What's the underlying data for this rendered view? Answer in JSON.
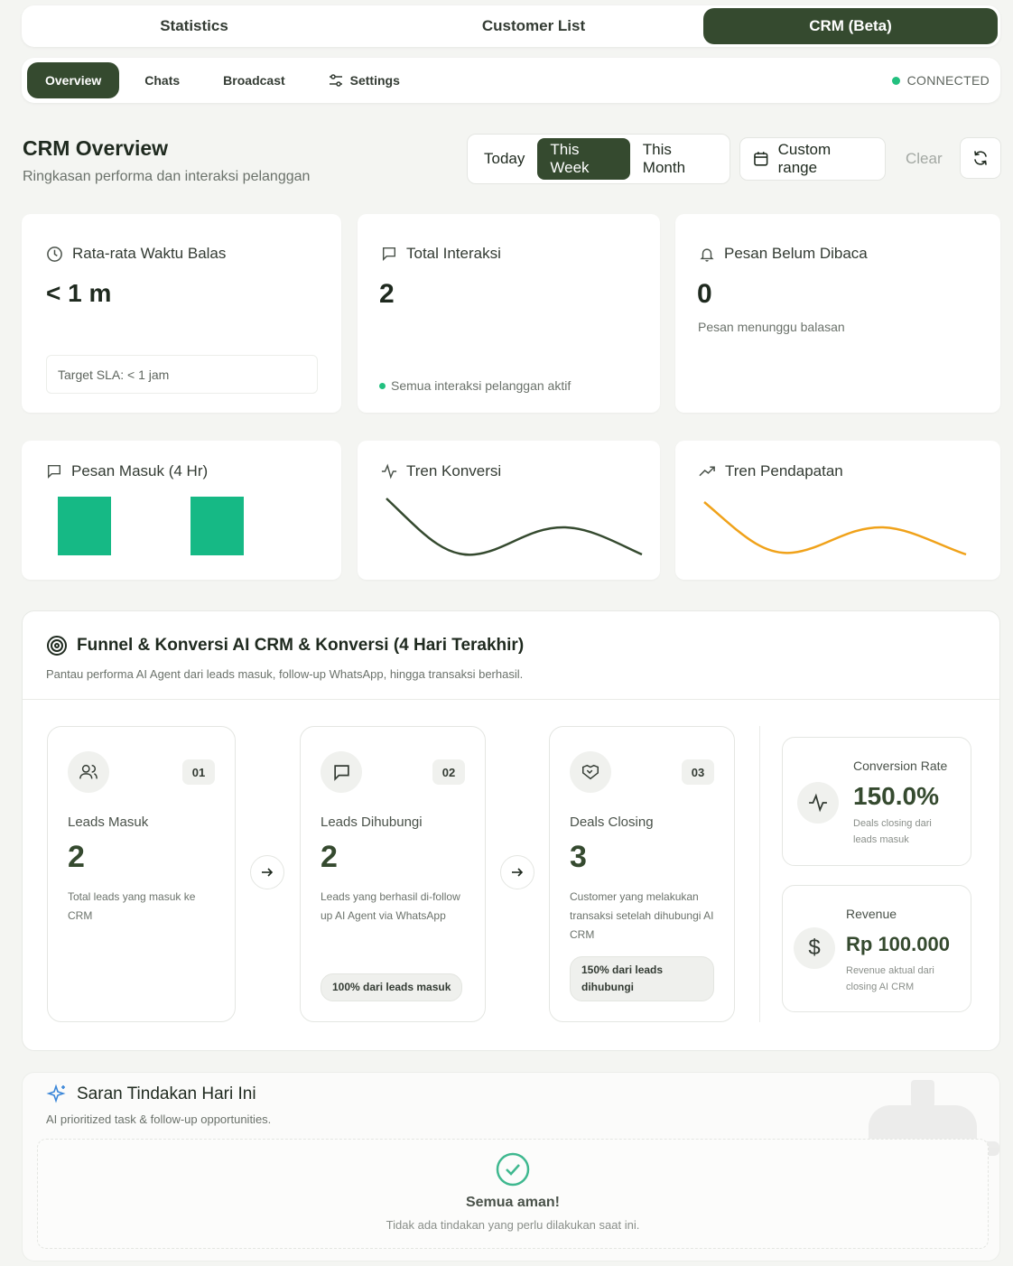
{
  "top_tabs": [
    {
      "label": "Statistics"
    },
    {
      "label": "Customer List"
    },
    {
      "label": "CRM (Beta)"
    }
  ],
  "subnav": {
    "items": [
      {
        "label": "Overview"
      },
      {
        "label": "Chats"
      },
      {
        "label": "Broadcast"
      },
      {
        "label": "Settings",
        "icon": "sliders-icon"
      }
    ],
    "status": "CONNECTED",
    "status_color": "#22c07f"
  },
  "header": {
    "title": "CRM Overview",
    "subtitle": "Ringkasan performa dan interaksi pelanggan",
    "ranges": [
      "Today",
      "This Week",
      "This Month"
    ],
    "active_range": "This Week",
    "custom_range": "Custom range",
    "clear": "Clear"
  },
  "stats": {
    "reply_time": {
      "title": "Rata-rata Waktu Balas",
      "value": "< 1 m",
      "sla": "Target SLA: < 1 jam",
      "icon": "clock-icon"
    },
    "interactions": {
      "title": "Total Interaksi",
      "value": "2",
      "note": "Semua interaksi pelanggan aktif",
      "icon": "message-icon"
    },
    "unread": {
      "title": "Pesan Belum Dibaca",
      "value": "0",
      "note": "Pesan menunggu balasan",
      "icon": "bell-icon"
    }
  },
  "mini_charts": {
    "incoming": {
      "title": "Pesan Masuk (4 Hr)",
      "icon": "message-icon",
      "bar_color": "#16b985"
    },
    "conversion": {
      "title": "Tren Konversi",
      "icon": "activity-icon",
      "line_color": "#354a2f"
    },
    "revenue": {
      "title": "Tren Pendapatan",
      "icon": "trending-up-icon",
      "line_color": "#f0a21a"
    }
  },
  "funnel": {
    "title": "Funnel & Konversi AI CRM & Konversi (4 Hari Terakhir)",
    "subtitle": "Pantau performa AI Agent dari leads masuk, follow-up WhatsApp, hingga transaksi berhasil.",
    "stages": [
      {
        "num": "01",
        "label": "Leads Masuk",
        "value": "2",
        "desc": "Total leads yang masuk ke CRM",
        "pill": "",
        "icon": "users-icon"
      },
      {
        "num": "02",
        "label": "Leads Dihubungi",
        "value": "2",
        "desc": "Leads yang berhasil di-follow up AI Agent via WhatsApp",
        "pill": "100% dari leads masuk",
        "icon": "message-icon"
      },
      {
        "num": "03",
        "label": "Deals Closing",
        "value": "3",
        "desc": "Customer yang melakukan transaksi setelah dihubungi AI CRM",
        "pill": "150% dari leads dihubungi",
        "icon": "handshake-icon"
      }
    ],
    "conversion": {
      "label": "Conversion Rate",
      "value": "150.0%",
      "note": "Deals closing dari leads masuk"
    },
    "revenue": {
      "label": "Revenue",
      "value": "Rp 100.000",
      "note": "Revenue aktual dari closing AI CRM"
    }
  },
  "suggestions": {
    "title": "Saran Tindakan Hari Ini",
    "subtitle": "AI prioritized task & follow-up opportunities.",
    "empty_title": "Semua aman!",
    "empty_sub": "Tidak ada tindakan yang perlu dilakukan saat ini.",
    "accent": "#3fb88f"
  }
}
